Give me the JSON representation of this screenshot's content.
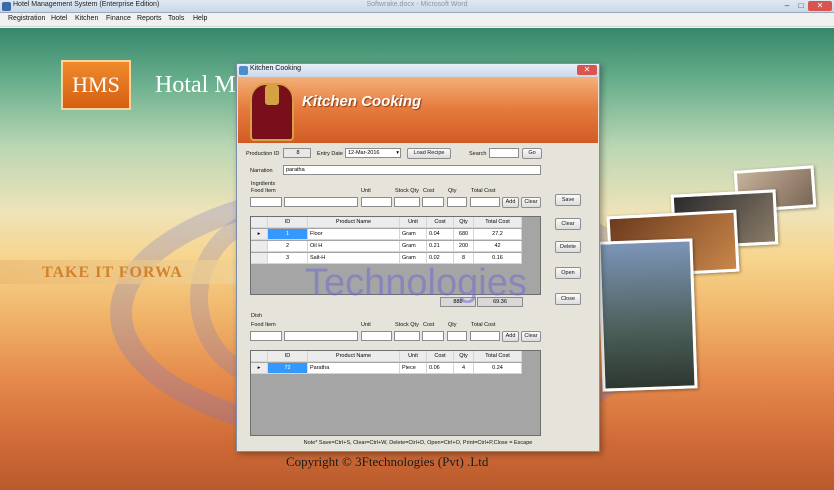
{
  "window": {
    "title": "Hotel Management System (Enterprise Edition)",
    "center_title": "Softwrake.docx - Microsoft Word",
    "min": "–",
    "max": "□",
    "close": "✕"
  },
  "menu": [
    "Registration",
    "Hotel",
    "Kitchen",
    "Finance",
    "Reports",
    "Tools",
    "Help"
  ],
  "background": {
    "logo_text": "HMS",
    "brand": "Hotal M",
    "slogan": "TAKE IT  FORWA",
    "copyright": "Copyright © 3Ftechnologies (Pvt) .Ltd",
    "watermark": "Technologies"
  },
  "dialog": {
    "title": "Kitchen Cooking",
    "close": "✕",
    "banner_title": "Kitchen Cooking",
    "production_id_label": "Production ID",
    "production_id": "8",
    "entry_date_label": "Entry Date",
    "entry_date": "12-Mar-2016",
    "load_recipe": "Load Recipe",
    "search_label": "Search",
    "search_value": "",
    "go": "Go",
    "narration_label": "Narration",
    "narration": "paratha",
    "ingredients_label": "Ingrdients",
    "food_item_label": "Food Item",
    "unit_label": "Unit",
    "stock_qty_label": "Stock Qty",
    "cost_label": "Cost",
    "qty_label": "Qty",
    "total_cost_label": "Total Cost",
    "add": "Add",
    "clear": "Clear",
    "ingredients_columns": [
      "ID",
      "Product Name",
      "Unit",
      "Cost",
      "Qty",
      "Total Cost"
    ],
    "ingredients_rows": [
      {
        "id": "1",
        "name": "Floor",
        "unit": "Gram",
        "cost": "0.04",
        "qty": "680",
        "total": "27.2"
      },
      {
        "id": "2",
        "name": "Oil H",
        "unit": "Gram",
        "cost": "0.21",
        "qty": "200",
        "total": "42"
      },
      {
        "id": "3",
        "name": "Salt-H",
        "unit": "Gram",
        "cost": "0.02",
        "qty": "8",
        "total": "0.16"
      }
    ],
    "ingredients_qty_total": "888",
    "ingredients_cost_total": "69.36",
    "dish_label": "Dish",
    "dish_columns": [
      "ID",
      "Product Name",
      "Unit",
      "Cost",
      "Qty",
      "Total Cost"
    ],
    "dish_rows": [
      {
        "id": "72",
        "name": "Paratha",
        "unit": "Piece",
        "cost": "0.06",
        "qty": "4",
        "total": "0.24"
      }
    ],
    "side_buttons": {
      "save": "Save",
      "clear": "Clear",
      "delete": "Delete",
      "open": "Open",
      "close": "Close"
    },
    "note": "Note* Save=Ctrl+S, Clear=Ctrl+W, Delete=Ctrl+D, Open=Ctrl+O, Print=Ctrl+P,Close = Escape"
  },
  "colors": {
    "accent": "#d15b24",
    "selection": "#3399ff"
  }
}
